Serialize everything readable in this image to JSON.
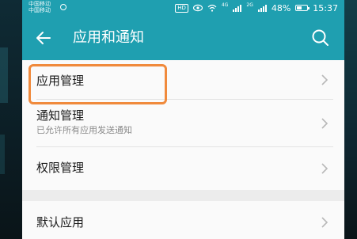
{
  "status_bar": {
    "carrier_1": "中国移动",
    "carrier_2": "中国移动",
    "hd_badge": "HD",
    "network_1": "4G",
    "network_2": "2G",
    "battery_level": "48%",
    "battery_fraction": 0.48,
    "time": "15:37"
  },
  "app_bar": {
    "title": "应用和通知",
    "back_icon": "arrow-left-icon",
    "search_icon": "search-icon"
  },
  "list": {
    "items": [
      {
        "label": "应用管理",
        "subtitle": ""
      },
      {
        "label": "通知管理",
        "subtitle": "已允许所有应用发送通知"
      },
      {
        "label": "权限管理",
        "subtitle": ""
      },
      {
        "label": "默认应用",
        "subtitle": ""
      }
    ]
  },
  "colors": {
    "accent": "#1f9fb0",
    "highlight": "#f08a3c"
  }
}
